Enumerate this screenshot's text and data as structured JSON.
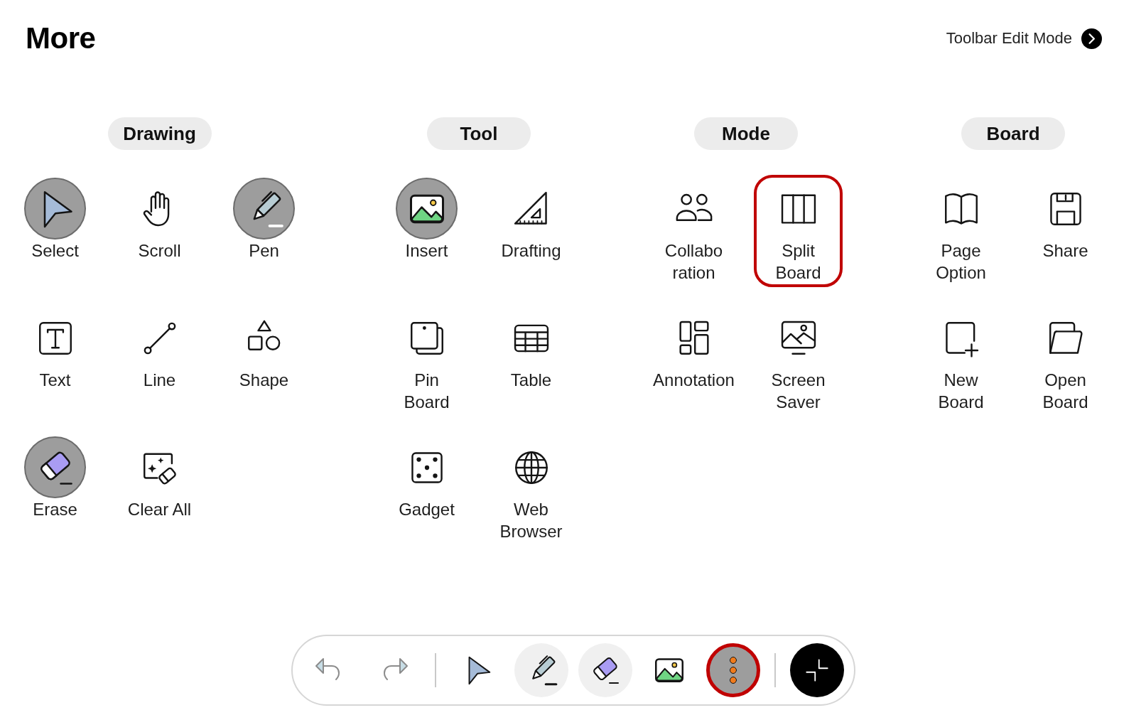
{
  "header": {
    "title": "More",
    "edit_mode_link": "Toolbar Edit Mode"
  },
  "sections": [
    {
      "title": "Drawing",
      "items": [
        {
          "label": "Select",
          "in_toolbar": true,
          "focused": false
        },
        {
          "label": "Scroll",
          "in_toolbar": false,
          "focused": false
        },
        {
          "label": "Pen",
          "in_toolbar": true,
          "focused": false
        },
        {
          "label": "Text",
          "in_toolbar": false,
          "focused": false
        },
        {
          "label": "Line",
          "in_toolbar": false,
          "focused": false
        },
        {
          "label": "Shape",
          "in_toolbar": false,
          "focused": false
        },
        {
          "label": "Erase",
          "in_toolbar": true,
          "focused": false
        },
        {
          "label": "Clear All",
          "in_toolbar": false,
          "focused": false
        }
      ]
    },
    {
      "title": "Tool",
      "items": [
        {
          "label": "Insert",
          "in_toolbar": true,
          "focused": false
        },
        {
          "label": "Drafting",
          "in_toolbar": false,
          "focused": false
        },
        {
          "label": "Pin\nBoard",
          "in_toolbar": false,
          "focused": false
        },
        {
          "label": "Table",
          "in_toolbar": false,
          "focused": false
        },
        {
          "label": "Gadget",
          "in_toolbar": false,
          "focused": false
        },
        {
          "label": "Web\nBrowser",
          "in_toolbar": false,
          "focused": false
        }
      ]
    },
    {
      "title": "Mode",
      "items": [
        {
          "label": "Collabo\nration",
          "in_toolbar": false,
          "focused": false
        },
        {
          "label": "Split\nBoard",
          "in_toolbar": false,
          "focused": true
        },
        {
          "label": "Annotation",
          "in_toolbar": false,
          "focused": false
        },
        {
          "label": "Screen\nSaver",
          "in_toolbar": false,
          "focused": false
        }
      ]
    },
    {
      "title": "Board",
      "items": [
        {
          "label": "Page\nOption",
          "in_toolbar": false,
          "focused": false
        },
        {
          "label": "Share",
          "in_toolbar": false,
          "focused": false
        },
        {
          "label": "New\nBoard",
          "in_toolbar": false,
          "focused": false
        },
        {
          "label": "Open\nBoard",
          "in_toolbar": false,
          "focused": false
        }
      ]
    }
  ],
  "bottom_toolbar": {
    "groups": [
      [
        {
          "kind": "plain",
          "disabled": true,
          "highlighted": false,
          "selected": false,
          "focused": false
        },
        {
          "kind": "plain",
          "disabled": true,
          "highlighted": false,
          "selected": false,
          "focused": false
        }
      ],
      [
        {
          "kind": "plain",
          "disabled": false,
          "highlighted": false,
          "selected": false,
          "focused": false
        },
        {
          "kind": "plain",
          "disabled": false,
          "highlighted": true,
          "selected": false,
          "focused": false
        },
        {
          "kind": "plain",
          "disabled": false,
          "highlighted": true,
          "selected": false,
          "focused": false
        },
        {
          "kind": "plain",
          "disabled": false,
          "highlighted": false,
          "selected": false,
          "focused": false
        },
        {
          "kind": "plain",
          "disabled": false,
          "highlighted": false,
          "selected": true,
          "focused": true
        }
      ],
      [
        {
          "kind": "dark"
        }
      ]
    ]
  }
}
